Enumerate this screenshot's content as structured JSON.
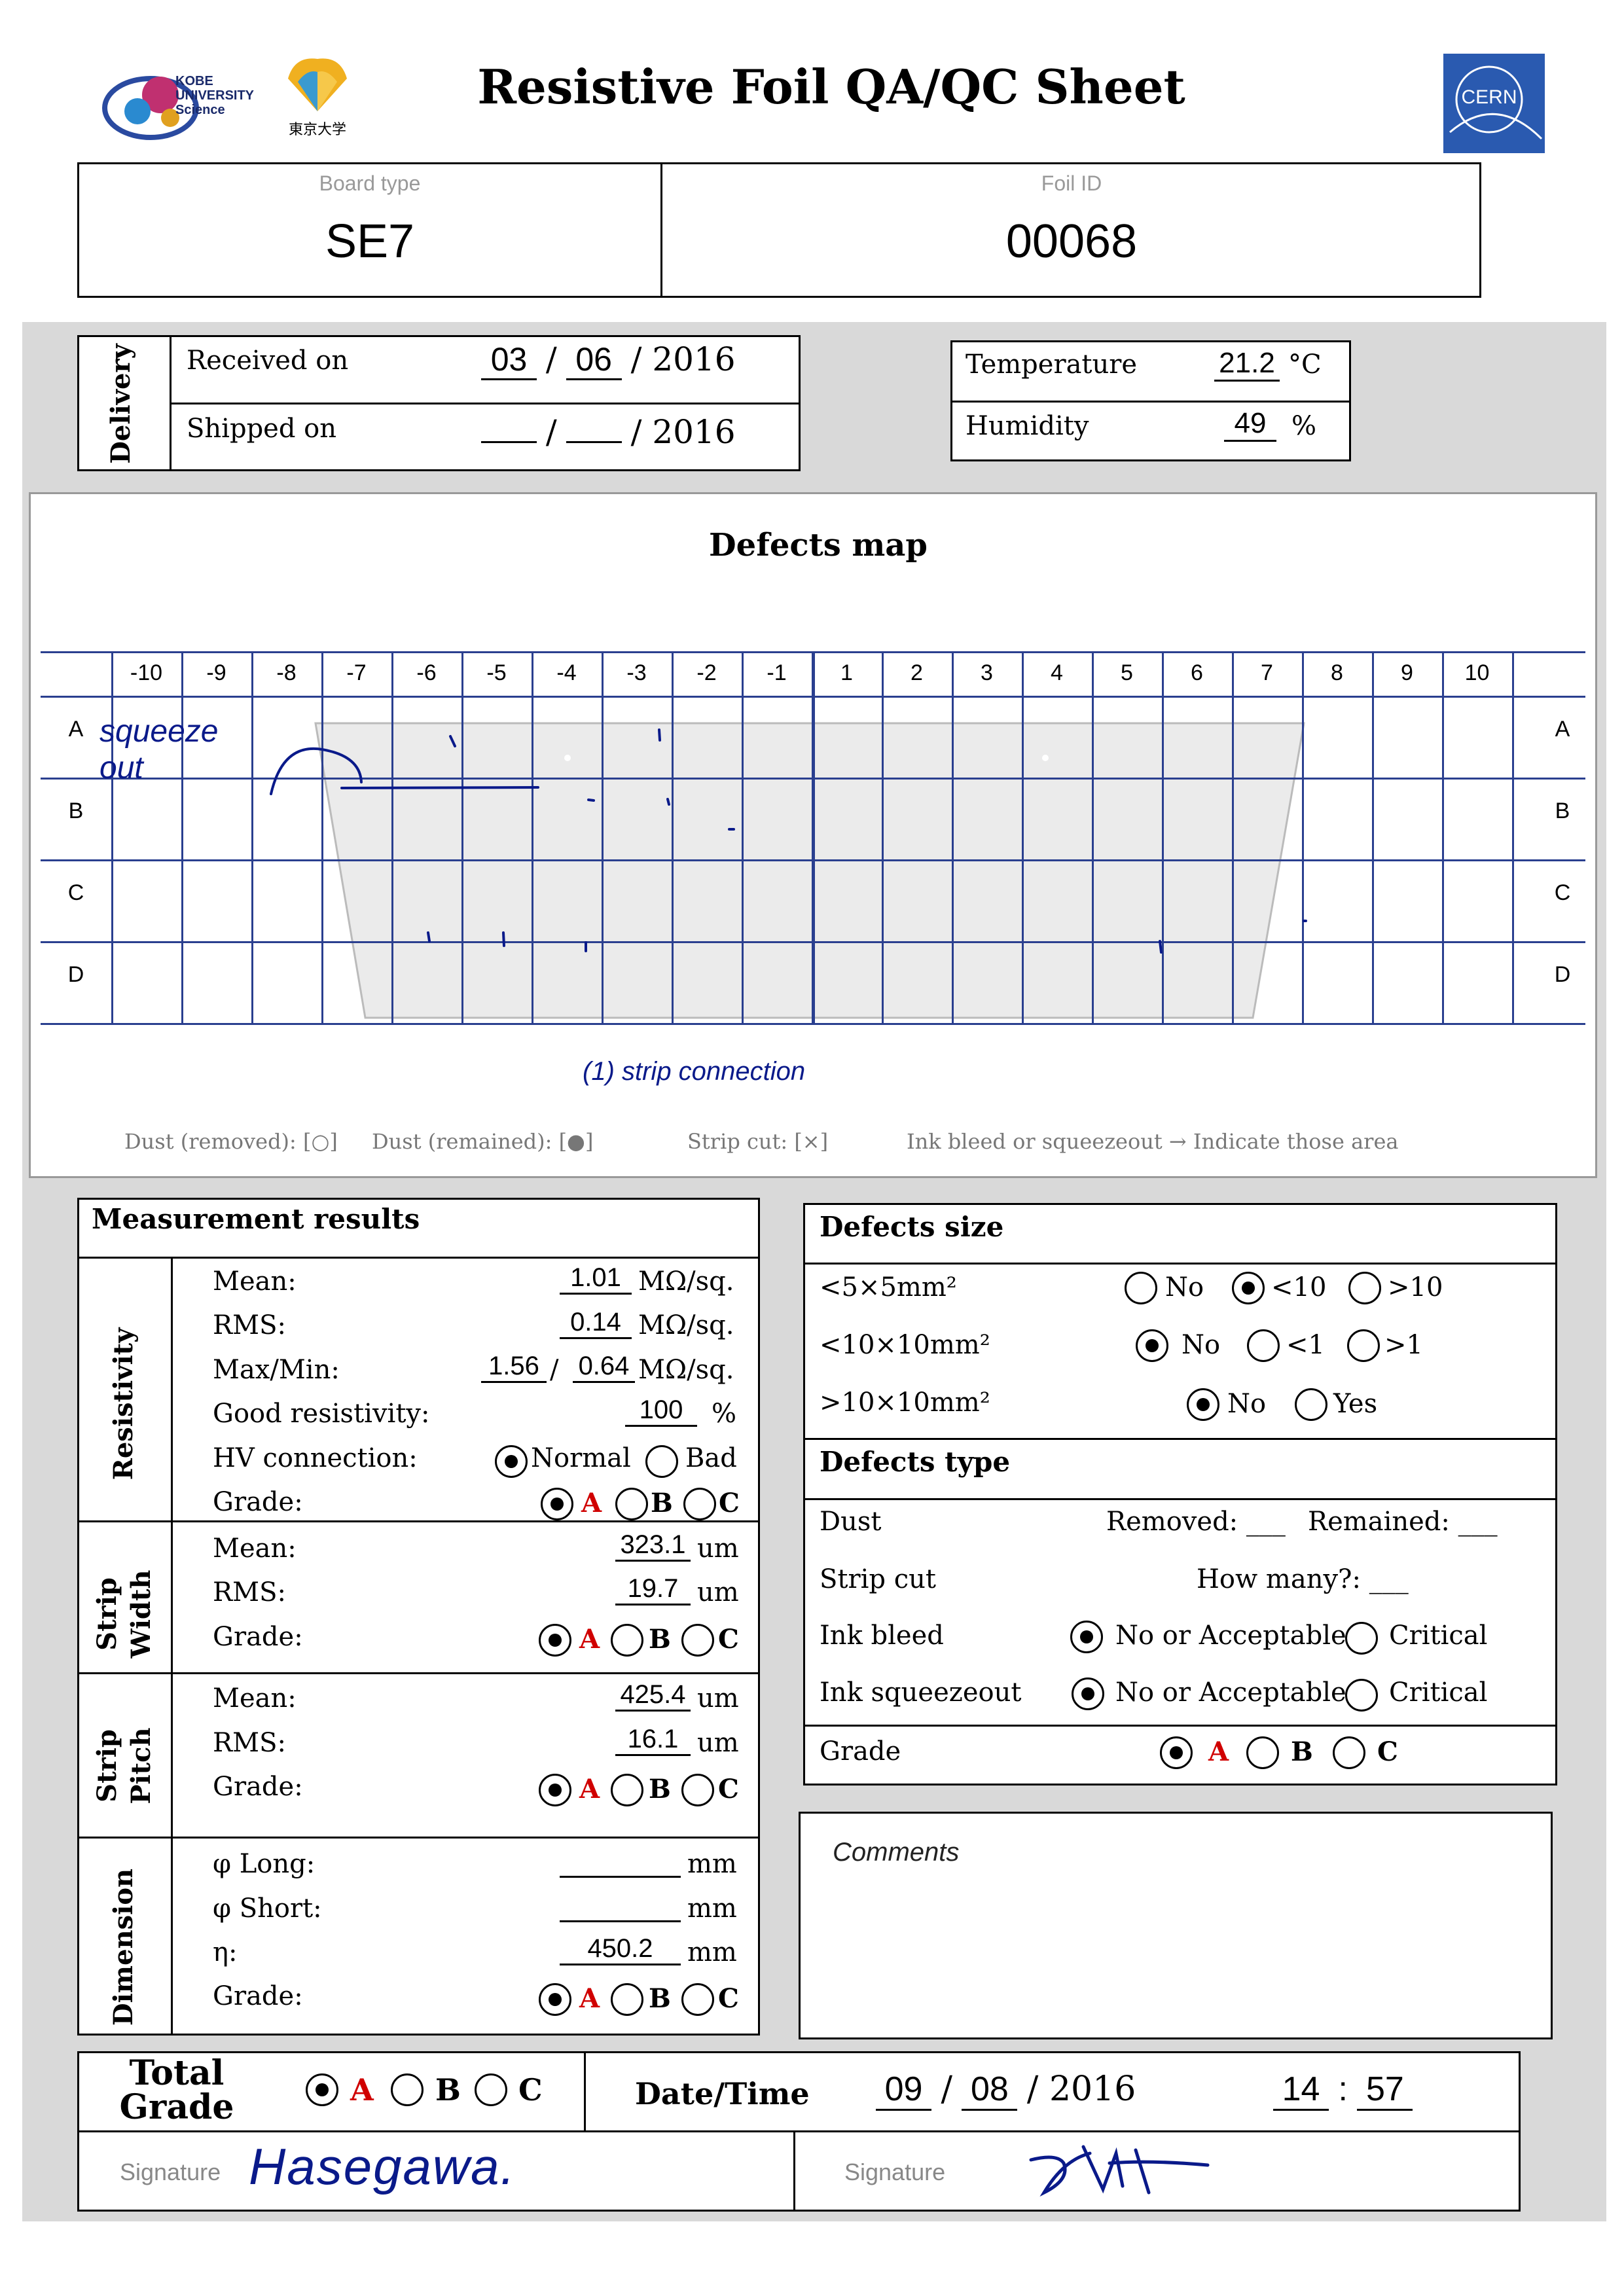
{
  "header": {
    "title": "Resistive Foil QA/QC Sheet",
    "logo_kobe_text": "KOBE UNIVERSITY Science",
    "logo_tokyo_text": "東京大学",
    "logo_cern_text": "CERN"
  },
  "ids": {
    "board_type_label": "Board type",
    "board_type_value": "SE7",
    "foil_id_label": "Foil ID",
    "foil_id_value": "00068"
  },
  "delivery": {
    "section_label": "Delivery",
    "received_label": "Received on",
    "received_month": "03",
    "received_day": "06",
    "received_year": "/ 2016",
    "shipped_label": "Shipped on",
    "shipped_year": "/ 2016",
    "sep": "/"
  },
  "environment": {
    "temperature_label": "Temperature",
    "temperature_value": "21.2",
    "temperature_unit": "°C",
    "humidity_label": "Humidity",
    "humidity_value": "49",
    "humidity_unit": "%"
  },
  "defects_map": {
    "title": "Defects map",
    "columns": [
      "-10",
      "-9",
      "-8",
      "-7",
      "-6",
      "-5",
      "-4",
      "-3",
      "-2",
      "-1",
      "1",
      "2",
      "3",
      "4",
      "5",
      "6",
      "7",
      "8",
      "9",
      "10"
    ],
    "rows": [
      "A",
      "B",
      "C",
      "D"
    ],
    "annotation_left": "squeeze out",
    "annotation_bottom": "(1) strip connection",
    "legend": {
      "dust_removed": "Dust (removed): [○]",
      "dust_remained": "Dust (remained): [●]",
      "strip_cut": "Strip cut: [×]",
      "ink": "Ink bleed or squeezeout → Indicate those area"
    }
  },
  "measurement": {
    "title": "Measurement results",
    "resistivity": {
      "section_label": "Resistivity",
      "mean_label": "Mean:",
      "mean_value": "1.01",
      "mean_unit": "MΩ/sq.",
      "rms_label": "RMS:",
      "rms_value": "0.14",
      "rms_unit": "MΩ/sq.",
      "maxmin_label": "Max/Min:",
      "max_value": "1.56",
      "min_value": "0.64",
      "maxmin_unit": "MΩ/sq.",
      "maxmin_sep": "/",
      "good_label": "Good resistivity:",
      "good_value": "100",
      "good_unit": "%",
      "hv_label": "HV connection:",
      "hv_normal": "Normal",
      "hv_bad": "Bad",
      "hv_selected": "Normal",
      "grade_label": "Grade:",
      "grade_selected": "A"
    },
    "strip_width": {
      "section_label": "Strip Width",
      "mean_label": "Mean:",
      "mean_value": "323.1",
      "mean_unit": "um",
      "rms_label": "RMS:",
      "rms_value": "19.7",
      "rms_unit": "um",
      "grade_label": "Grade:",
      "grade_selected": "A"
    },
    "strip_pitch": {
      "section_label": "Strip Pitch",
      "mean_label": "Mean:",
      "mean_value": "425.4",
      "mean_unit": "um",
      "rms_label": "RMS:",
      "rms_value": "16.1",
      "rms_unit": "um",
      "grade_label": "Grade:",
      "grade_selected": "A"
    },
    "dimension": {
      "section_label": "Dimension",
      "long_label": "φ Long:",
      "long_value": "",
      "long_unit": "mm",
      "short_label": "φ Short:",
      "short_value": "",
      "short_unit": "mm",
      "eta_label": "η:",
      "eta_value": "450.2",
      "eta_unit": "mm",
      "grade_label": "Grade:",
      "grade_selected": "A"
    },
    "grades": [
      "A",
      "B",
      "C"
    ]
  },
  "defects_size": {
    "title": "Defects size",
    "row1_label": "<5×5mm²",
    "row1_opts": [
      "No",
      "<10",
      ">10"
    ],
    "row1_selected": "<10",
    "row2_label": "<10×10mm²",
    "row2_opts": [
      "No",
      "<1",
      ">1"
    ],
    "row2_selected": "No",
    "row3_label": ">10×10mm²",
    "row3_opts": [
      "No",
      "Yes"
    ],
    "row3_selected": "No"
  },
  "defects_type": {
    "title": "Defects type",
    "dust_label": "Dust",
    "dust_removed": "Removed: ___",
    "dust_remained": "Remained: ___",
    "strip_cut_label": "Strip cut",
    "strip_cut_howmany": "How many?: ___",
    "ink_bleed_label": "Ink bleed",
    "ink_squeeze_label": "Ink squeezeout",
    "opt_ok": "No or Acceptable",
    "opt_critical": "Critical",
    "grade_label": "Grade",
    "grade_selected": "A"
  },
  "comments": {
    "label": "Comments"
  },
  "total": {
    "label": "Total Grade",
    "grade_selected": "A",
    "datetime_label": "Date/Time",
    "day": "09",
    "month": "08",
    "year": "/ 2016",
    "hour": "14",
    "minute": "57",
    "time_sep": ":",
    "sep": "/",
    "signature_label": "Signature",
    "signature_left": "Hasegawa."
  },
  "colors": {
    "ink": "#0a1a8a",
    "grid": "#2a3f8f",
    "grade_red": "#d00000",
    "panel_gray": "#d9d9d9"
  }
}
